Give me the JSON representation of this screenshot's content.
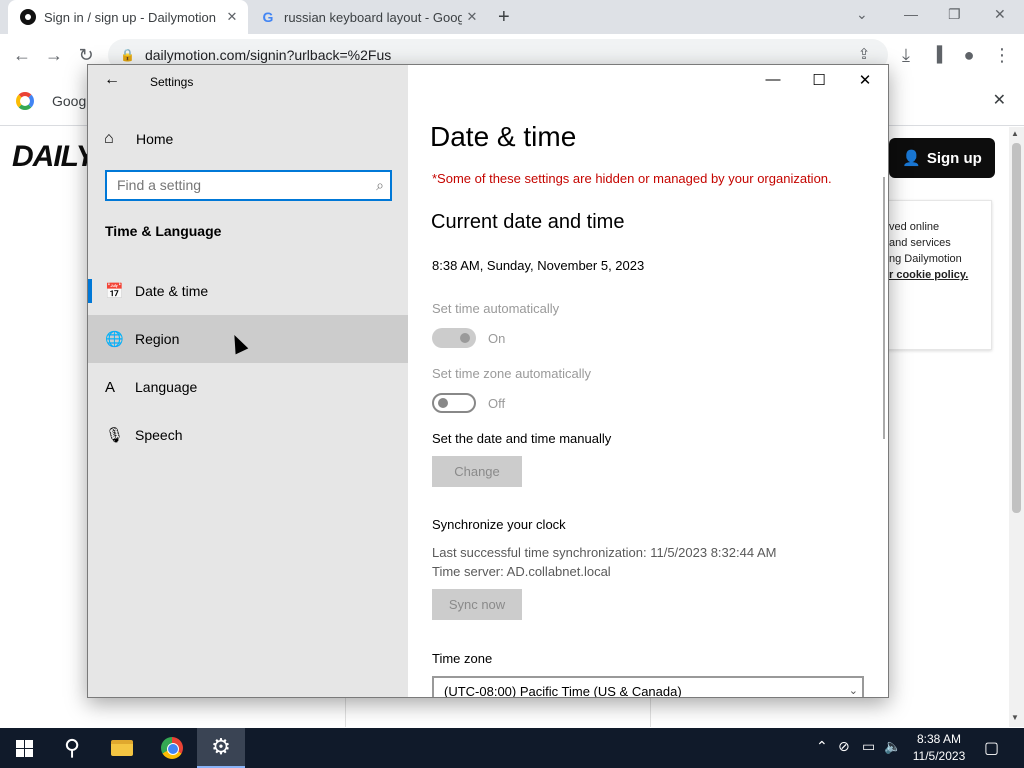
{
  "browser": {
    "tabs": [
      {
        "title": "Sign in / sign up - Dailymotion",
        "close": "✕"
      },
      {
        "title": "russian keyboard layout - Google",
        "close": "✕"
      }
    ],
    "new_tab": "+",
    "url": "dailymotion.com/signin?urlback=%2Fus",
    "infobar_text": "Googl",
    "infobar_close": "✕"
  },
  "page": {
    "logo": "DAILYM",
    "signup_label": "Sign up",
    "cookie_lines": [
      "ved online",
      "and services",
      "ng Dailymotion"
    ],
    "cookie_link": "r cookie policy."
  },
  "settings": {
    "window_title": "Settings",
    "home_label": "Home",
    "search_placeholder": "Find a setting",
    "section_title": "Time & Language",
    "nav": [
      {
        "label": "Date & time",
        "icon": "calendar-clock-icon"
      },
      {
        "label": "Region",
        "icon": "globe-icon"
      },
      {
        "label": "Language",
        "icon": "language-icon"
      },
      {
        "label": "Speech",
        "icon": "microphone-icon"
      }
    ],
    "page_title": "Date & time",
    "managed_warning": "*Some of these settings are hidden or managed by your organization.",
    "current_heading": "Current date and time",
    "current_value": "8:38 AM, Sunday, November 5, 2023",
    "set_time_auto_label": "Set time automatically",
    "set_time_auto_state": "On",
    "set_tz_auto_label": "Set time zone automatically",
    "set_tz_auto_state": "Off",
    "manual_label": "Set the date and time manually",
    "change_button": "Change",
    "sync_heading": "Synchronize your clock",
    "sync_last": "Last successful time synchronization: 11/5/2023 8:32:44 AM",
    "sync_server": "Time server: AD.collabnet.local",
    "sync_button": "Sync now",
    "tz_label": "Time zone",
    "tz_value": "(UTC-08:00) Pacific Time (US & Canada)"
  },
  "taskbar": {
    "time": "8:38 AM",
    "date": "11/5/2023"
  },
  "colors": {
    "accent": "#0078d7",
    "warning": "#c50500",
    "taskbar": "#101a2a"
  }
}
